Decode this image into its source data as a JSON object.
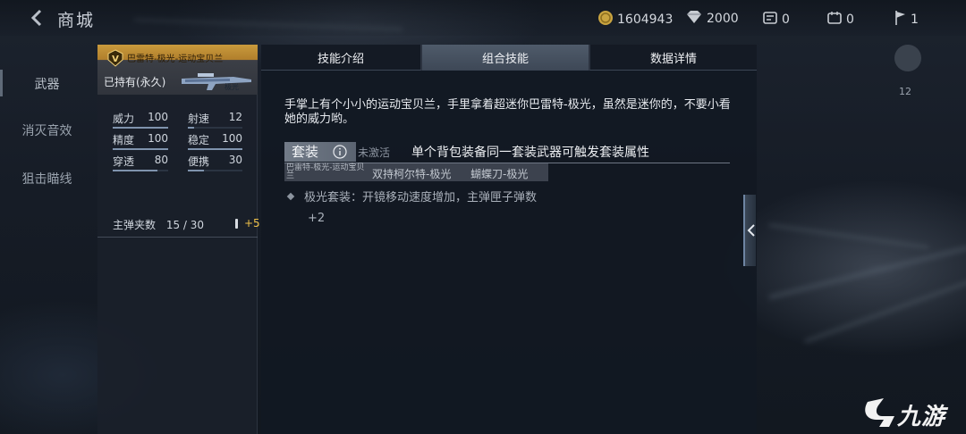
{
  "topbar": {
    "title": "商城",
    "resources": [
      {
        "icon": "coin-icon",
        "value": "1604943"
      },
      {
        "icon": "diamond-icon",
        "value": "2000"
      },
      {
        "icon": "ticket-icon",
        "value": "0"
      },
      {
        "icon": "voucher-icon",
        "value": "0"
      },
      {
        "icon": "flag-icon",
        "value": "1"
      }
    ]
  },
  "left_nav": {
    "items": [
      "武器",
      "消灭音效",
      "狙击瞄线"
    ]
  },
  "weapon_card": {
    "rank": "V",
    "name": "巴雷特-极光-运动宝贝兰",
    "ownership": "已持有(永久)",
    "gun_tag": "极光",
    "stats": [
      {
        "label": "威力",
        "value": "100",
        "fill": 1.0
      },
      {
        "label": "射速",
        "value": "12",
        "fill": 0.12
      },
      {
        "label": "精度",
        "value": "100",
        "fill": 1.0
      },
      {
        "label": "稳定",
        "value": "100",
        "fill": 1.0
      },
      {
        "label": "穿透",
        "value": "80",
        "fill": 0.8
      },
      {
        "label": "便携",
        "value": "30",
        "fill": 0.3
      }
    ],
    "magazine": {
      "label": "主弹夹数",
      "value": "15 / 30",
      "bonus": "+5"
    }
  },
  "tabs": [
    "技能介绍",
    "组合技能",
    "数据详情"
  ],
  "active_tab": "组合技能",
  "skill": {
    "description": "手掌上有个小小的运动宝贝兰，手里拿着超迷你巴雷特-极光，虽然是迷你的，不要小看她的威力哟。",
    "set_label": "套装",
    "set_status": "未激活",
    "set_hint": "单个背包装备同一套装武器可触发套装属性",
    "members": [
      "巴雷特-极光-运动宝贝兰",
      "双持柯尔特-极光",
      "蝴蝶刀-极光"
    ],
    "bonus_text": "极光套装：开镜移动速度增加，主弹匣子弹数",
    "bonus_value": "+2"
  },
  "side_panel": {
    "number": "12"
  },
  "watermark": {
    "text": "九游"
  }
}
